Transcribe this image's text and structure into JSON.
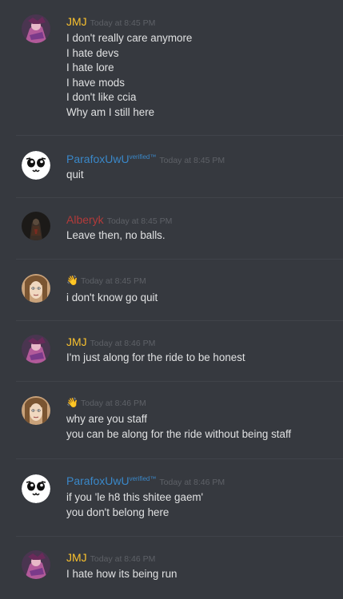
{
  "messages": [
    {
      "username": "JMJ",
      "user_color": "#f9c12e",
      "verified": "",
      "timestamp": "Today at 8:45 PM",
      "avatar": "jmj-avatar",
      "lines": [
        "I don't really care anymore",
        "I hate devs",
        "I hate lore",
        "I have mods",
        "I don't like ccia",
        "Why am I still here"
      ]
    },
    {
      "username": "ParafoxUwU",
      "user_color": "#3a88c9",
      "verified": "verified™",
      "timestamp": "Today at 8:45 PM",
      "avatar": "parafox-avatar",
      "lines": [
        "quit"
      ]
    },
    {
      "username": "Alberyk",
      "user_color": "#b23a3a",
      "verified": "",
      "timestamp": "Today at 8:45 PM",
      "avatar": "alberyk-avatar",
      "lines": [
        "Leave then, no balls."
      ]
    },
    {
      "username": "👋",
      "user_color": "#ffffff",
      "verified": "",
      "timestamp": "Today at 8:45 PM",
      "avatar": "wave-user-avatar",
      "lines": [
        "i don't know go quit"
      ]
    },
    {
      "username": "JMJ",
      "user_color": "#f9c12e",
      "verified": "",
      "timestamp": "Today at 8:46 PM",
      "avatar": "jmj-avatar",
      "lines": [
        "I'm just along for the ride to be honest"
      ]
    },
    {
      "username": "👋",
      "user_color": "#ffffff",
      "verified": "",
      "timestamp": "Today at 8:46 PM",
      "avatar": "wave-user-avatar",
      "lines": [
        "why are you staff",
        "you can be along for the ride without being staff"
      ]
    },
    {
      "username": "ParafoxUwU",
      "user_color": "#3a88c9",
      "verified": "verified™",
      "timestamp": "Today at 8:46 PM",
      "avatar": "parafox-avatar",
      "lines": [
        "if you 'le h8 this shitee gaem'",
        "you don't belong here"
      ]
    },
    {
      "username": "JMJ",
      "user_color": "#f9c12e",
      "verified": "",
      "timestamp": "Today at 8:46 PM",
      "avatar": "jmj-avatar",
      "lines": [
        "I hate how its being run"
      ]
    }
  ]
}
